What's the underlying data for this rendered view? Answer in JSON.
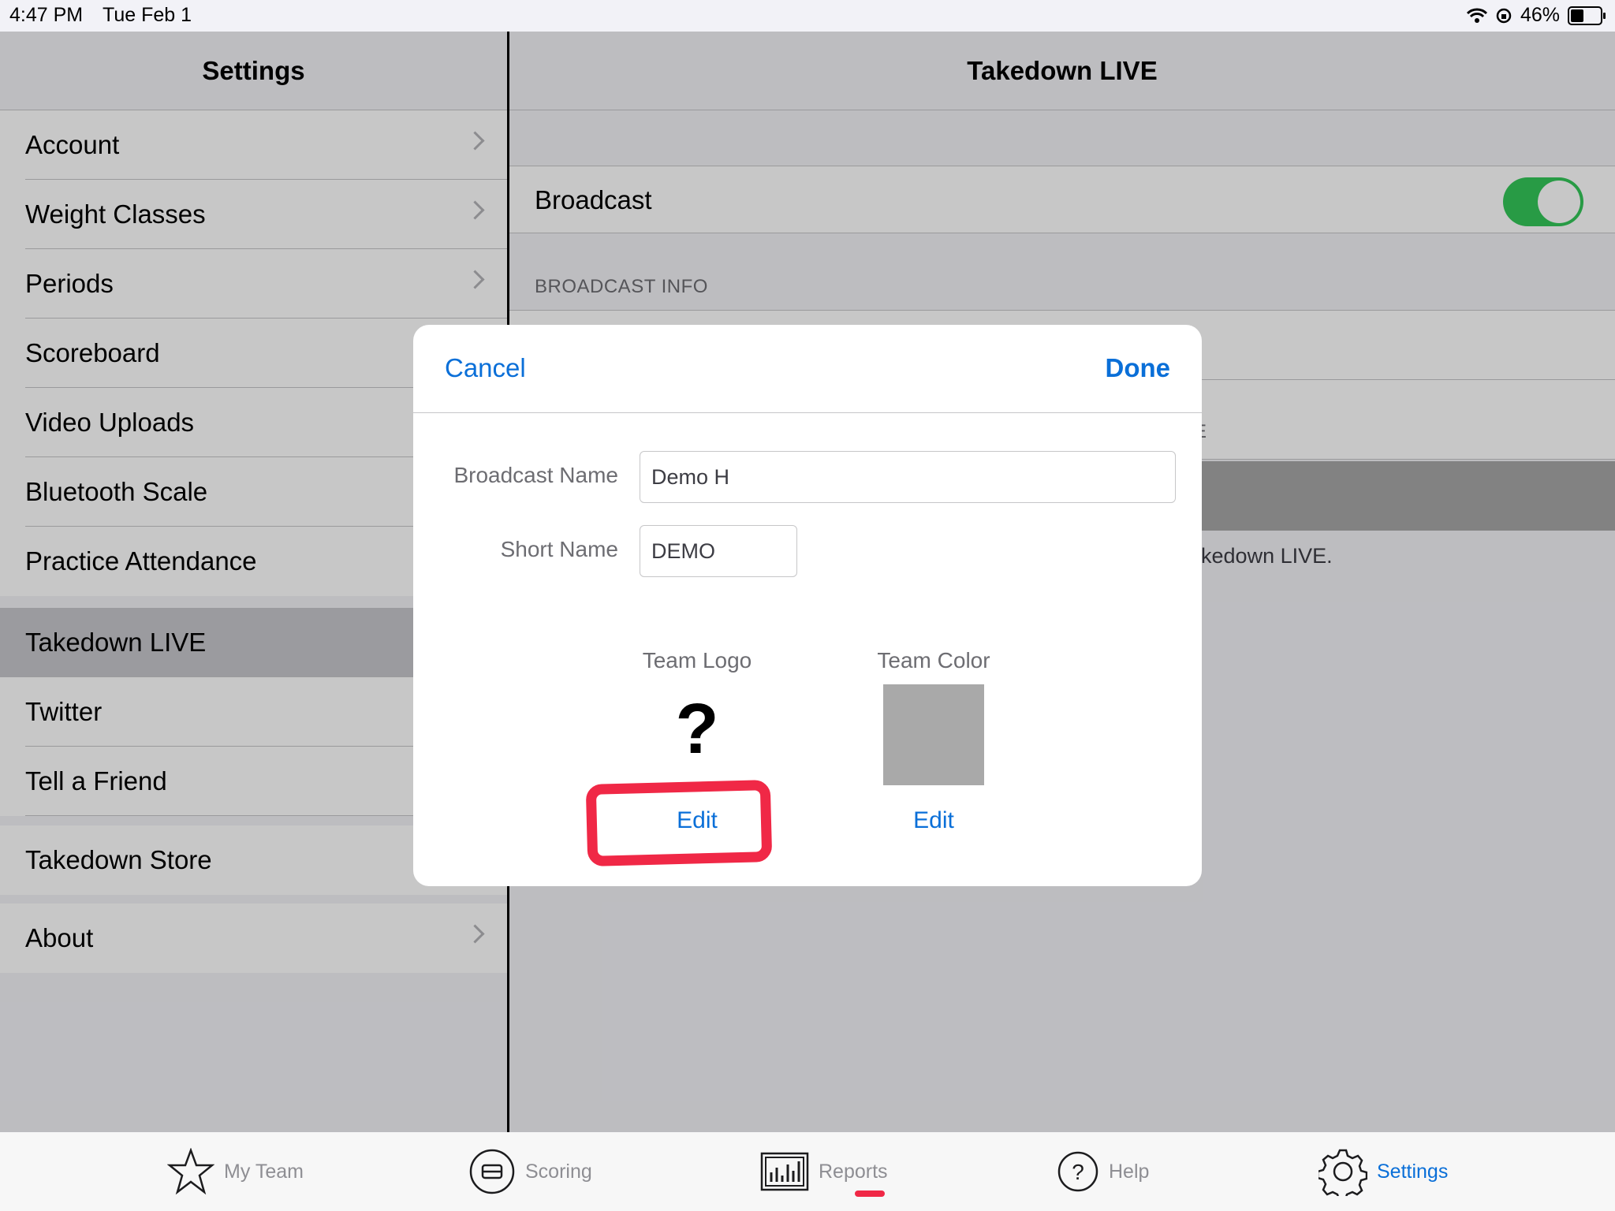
{
  "status_bar": {
    "time": "4:47 PM",
    "date": "Tue Feb 1",
    "battery": "46%"
  },
  "sidebar": {
    "title": "Settings",
    "items": [
      {
        "label": "Account",
        "chevron": true
      },
      {
        "label": "Weight Classes",
        "chevron": true
      },
      {
        "label": "Periods",
        "chevron": true
      },
      {
        "label": "Scoreboard",
        "chevron": false
      },
      {
        "label": "Video Uploads",
        "chevron": false
      },
      {
        "label": "Bluetooth Scale",
        "chevron": false
      },
      {
        "label": "Practice Attendance",
        "chevron": false
      },
      {
        "label": "Takedown LIVE",
        "chevron": false,
        "selected": true
      },
      {
        "label": "Twitter",
        "chevron": false
      },
      {
        "label": "Tell a Friend",
        "chevron": false
      },
      {
        "label": "Takedown Store",
        "chevron": false
      },
      {
        "label": "About",
        "chevron": true
      }
    ]
  },
  "main": {
    "title": "Takedown LIVE",
    "broadcast_label": "Broadcast",
    "broadcast_on": true,
    "section_header": "BROADCAST INFO",
    "partial_text_1": "E",
    "partial_footer": "akedown LIVE."
  },
  "modal": {
    "cancel_label": "Cancel",
    "done_label": "Done",
    "broadcast_name_label": "Broadcast Name",
    "broadcast_name_value": "Demo H",
    "short_name_label": "Short Name",
    "short_name_value": "DEMO",
    "team_logo_label": "Team Logo",
    "team_logo_placeholder": "?",
    "team_color_label": "Team Color",
    "team_color": "#a9a9a9",
    "logo_edit_label": "Edit",
    "color_edit_label": "Edit"
  },
  "tabbar": {
    "tabs": [
      {
        "label": "My Team",
        "icon": "star-icon"
      },
      {
        "label": "Scoring",
        "icon": "scoring-icon"
      },
      {
        "label": "Reports",
        "icon": "reports-icon"
      },
      {
        "label": "Help",
        "icon": "help-icon"
      },
      {
        "label": "Settings",
        "icon": "gear-icon",
        "active": true
      }
    ]
  },
  "colors": {
    "accent": "#0a6fd8",
    "toggle_on": "#34c759",
    "annotation": "#f02846"
  }
}
